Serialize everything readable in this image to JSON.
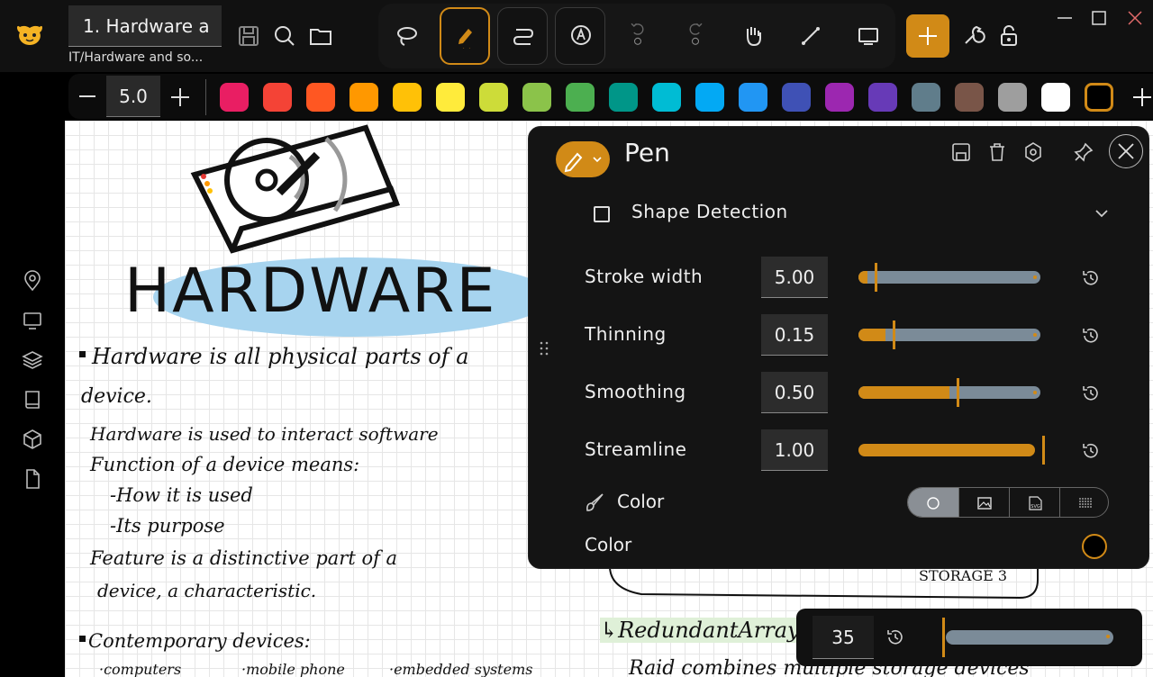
{
  "document": {
    "title": "1. Hardware a",
    "path": "IT/Hardware and so..."
  },
  "toolbar": {
    "icons": [
      "save-icon",
      "search-icon",
      "folder-icon",
      "lasso-icon",
      "pen-icon",
      "path-icon",
      "text-icon",
      "undo-icon",
      "redo-icon",
      "hand-icon",
      "line-icon",
      "screen-icon",
      "plus-icon",
      "wrench-icon",
      "lock-icon"
    ],
    "accent": "#d18a17"
  },
  "colorbar": {
    "stroke_value": "5.0",
    "colors": [
      "#e91e63",
      "#f44336",
      "#ff5722",
      "#ff9800",
      "#ffc107",
      "#ffeb3b",
      "#cddc39",
      "#8bc34a",
      "#4caf50",
      "#009688",
      "#00bcd4",
      "#03a9f4",
      "#2196f3",
      "#3f51b5",
      "#9c27b0",
      "#673ab7",
      "#607d8b",
      "#795548",
      "#9e9e9e",
      "#ffffff",
      "#000000"
    ],
    "selected_index": 20
  },
  "sidebar": {
    "icons": [
      "location-pin-icon",
      "monitor-icon",
      "layers-icon",
      "book-icon",
      "cube-icon",
      "file-icon"
    ]
  },
  "canvas": {
    "heading": "HARDWARE",
    "lines": [
      "Hardware is all physical parts of a",
      "device.",
      "Hardware is used to interact software",
      "Function of a device means:",
      "-How it is used",
      "-Its purpose",
      "Feature is a distinctive part of a",
      "device, a characteristic.",
      "Contemporary devices:",
      "·computers",
      "·mobile phone",
      "·embedded systems"
    ],
    "right_lines": [
      "STORAGE 3",
      "↳RedundantArrayof",
      "Raid combines multiple storage devices"
    ]
  },
  "pen_panel": {
    "title": "Pen",
    "shape_detection_label": "Shape Detection",
    "shape_detection_checked": false,
    "sliders": [
      {
        "label": "Stroke width",
        "value": "5.00",
        "fraction": 0.05
      },
      {
        "label": "Thinning",
        "value": "0.15",
        "fraction": 0.15
      },
      {
        "label": "Smoothing",
        "value": "0.50",
        "fraction": 0.5
      },
      {
        "label": "Streamline",
        "value": "1.00",
        "fraction": 0.97
      }
    ],
    "color_label": "Color",
    "color_modes": [
      "circle-icon",
      "image-icon",
      "svg-icon",
      "pattern-icon"
    ],
    "color_mode_selected": 0,
    "color2_label": "Color"
  },
  "size_panel": {
    "value": "35",
    "fraction": 0.02
  }
}
